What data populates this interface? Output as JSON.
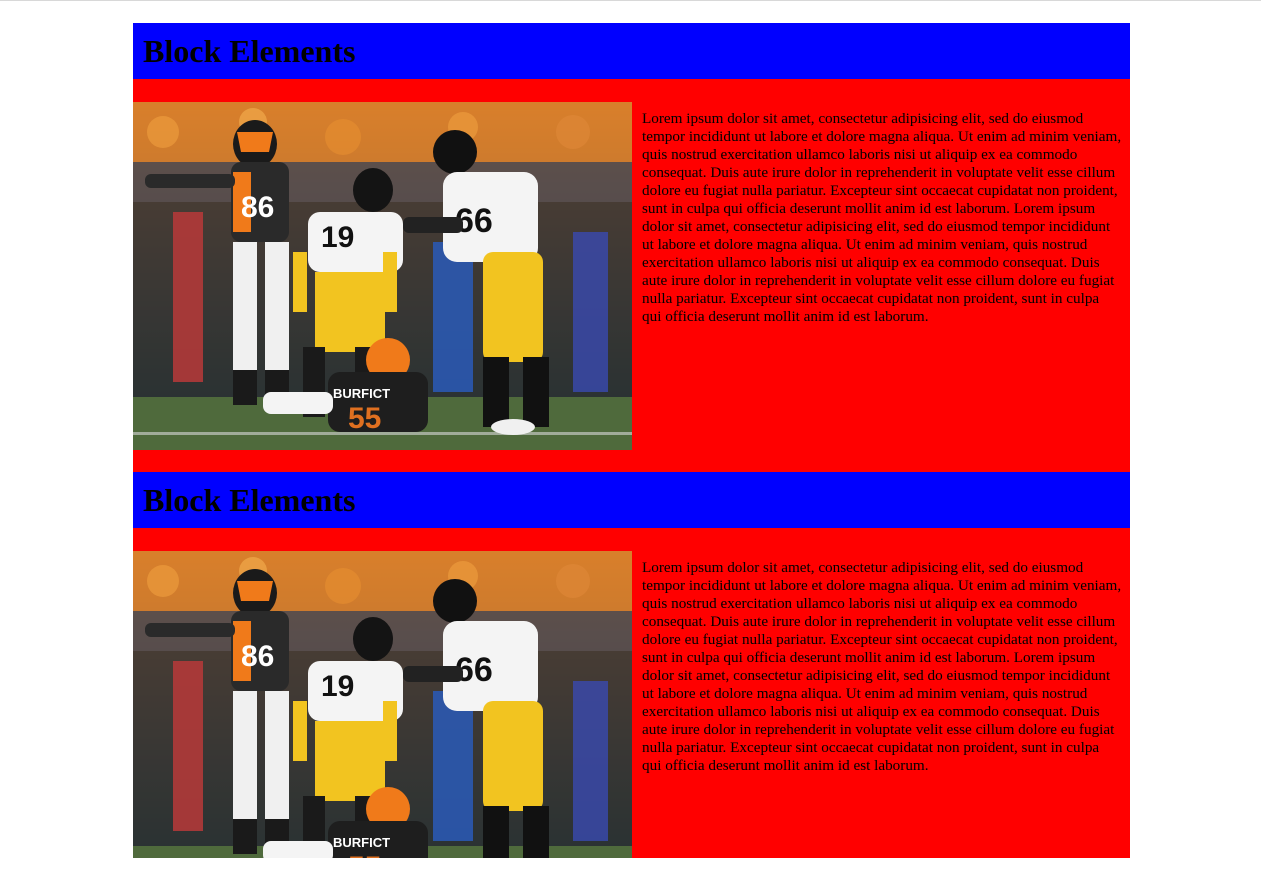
{
  "sections": [
    {
      "title": "Block Elements",
      "text": "Lorem ipsum dolor sit amet, consectetur adipisicing elit, sed do eiusmod tempor incididunt ut labore et dolore magna aliqua. Ut enim ad minim veniam, quis nostrud exercitation ullamco laboris nisi ut aliquip ex ea commodo consequat. Duis aute irure dolor in reprehenderit in voluptate velit esse cillum dolore eu fugiat nulla pariatur. Excepteur sint occaecat cupidatat non proident, sunt in culpa qui officia deserunt mollit anim id est laborum. Lorem ipsum dolor sit amet, consectetur adipisicing elit, sed do eiusmod tempor incididunt ut labore et dolore magna aliqua. Ut enim ad minim veniam, quis nostrud exercitation ullamco laboris nisi ut aliquip ex ea commodo consequat. Duis aute irure dolor in reprehenderit in voluptate velit esse cillum dolore eu fugiat nulla pariatur. Excepteur sint occaecat cupidatat non proident, sunt in culpa qui officia deserunt mollit anim id est laborum."
    },
    {
      "title": "Block Elements",
      "text": "Lorem ipsum dolor sit amet, consectetur adipisicing elit, sed do eiusmod tempor incididunt ut labore et dolore magna aliqua. Ut enim ad minim veniam, quis nostrud exercitation ullamco laboris nisi ut aliquip ex ea commodo consequat. Duis aute irure dolor in reprehenderit in voluptate velit esse cillum dolore eu fugiat nulla pariatur. Excepteur sint occaecat cupidatat non proident, sunt in culpa qui officia deserunt mollit anim id est laborum. Lorem ipsum dolor sit amet, consectetur adipisicing elit, sed do eiusmod tempor incididunt ut labore et dolore magna aliqua. Ut enim ad minim veniam, quis nostrud exercitation ullamco laboris nisi ut aliquip ex ea commodo consequat. Duis aute irure dolor in reprehenderit in voluptate velit esse cillum dolore eu fugiat nulla pariatur. Excepteur sint occaecat cupidatat non proident, sunt in culpa qui officia deserunt mollit anim id est laborum."
    }
  ],
  "photo": {
    "jersey_numbers": [
      "86",
      "19",
      "66",
      "55"
    ],
    "player_name": "BURFICT"
  },
  "colors": {
    "header_bg": "#0000ff",
    "section_bg": "#ff0000",
    "page_bg": "#ffffff",
    "text": "#000000"
  }
}
